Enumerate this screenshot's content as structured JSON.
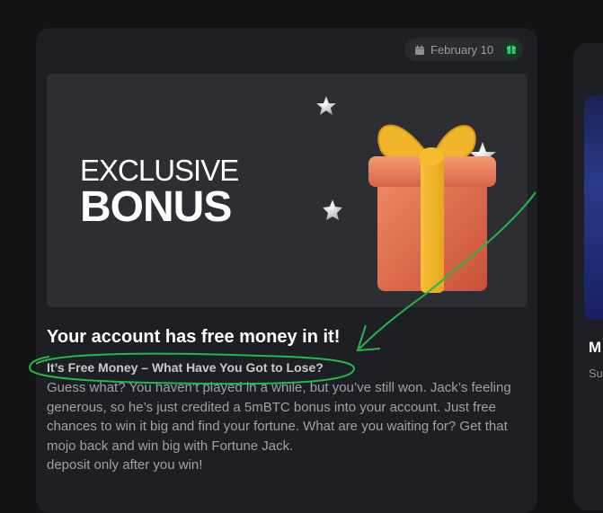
{
  "card": {
    "date": "February 10",
    "banner": {
      "line1": "EXCLUSIVE",
      "line2": "BONUS"
    },
    "title": "Your account has free money in it!",
    "subtitle": "It’s Free Money – What Have You Got to Lose?",
    "body": [
      "Guess what? You haven’t played in a while, but you’ve still won. Jack’s feeling generous, so he’s just credited a 5mBTC bonus into your account. Just free chances to win it big and find your fortune. What are you waiting for? Get that mojo back and win big with Fortune Jack.",
      "deposit only after you win!"
    ]
  },
  "right_card": {
    "title": "M",
    "subtitle": "Su"
  },
  "icons": {
    "date": "calendar-icon",
    "badge": "gift-icon",
    "banner": "gift-box-icon"
  },
  "colors": {
    "background": "#131316",
    "card": "#1e1f24",
    "banner": "#2d2e33",
    "badge_green": "#33c46a",
    "annotation_green": "#22b84a"
  }
}
